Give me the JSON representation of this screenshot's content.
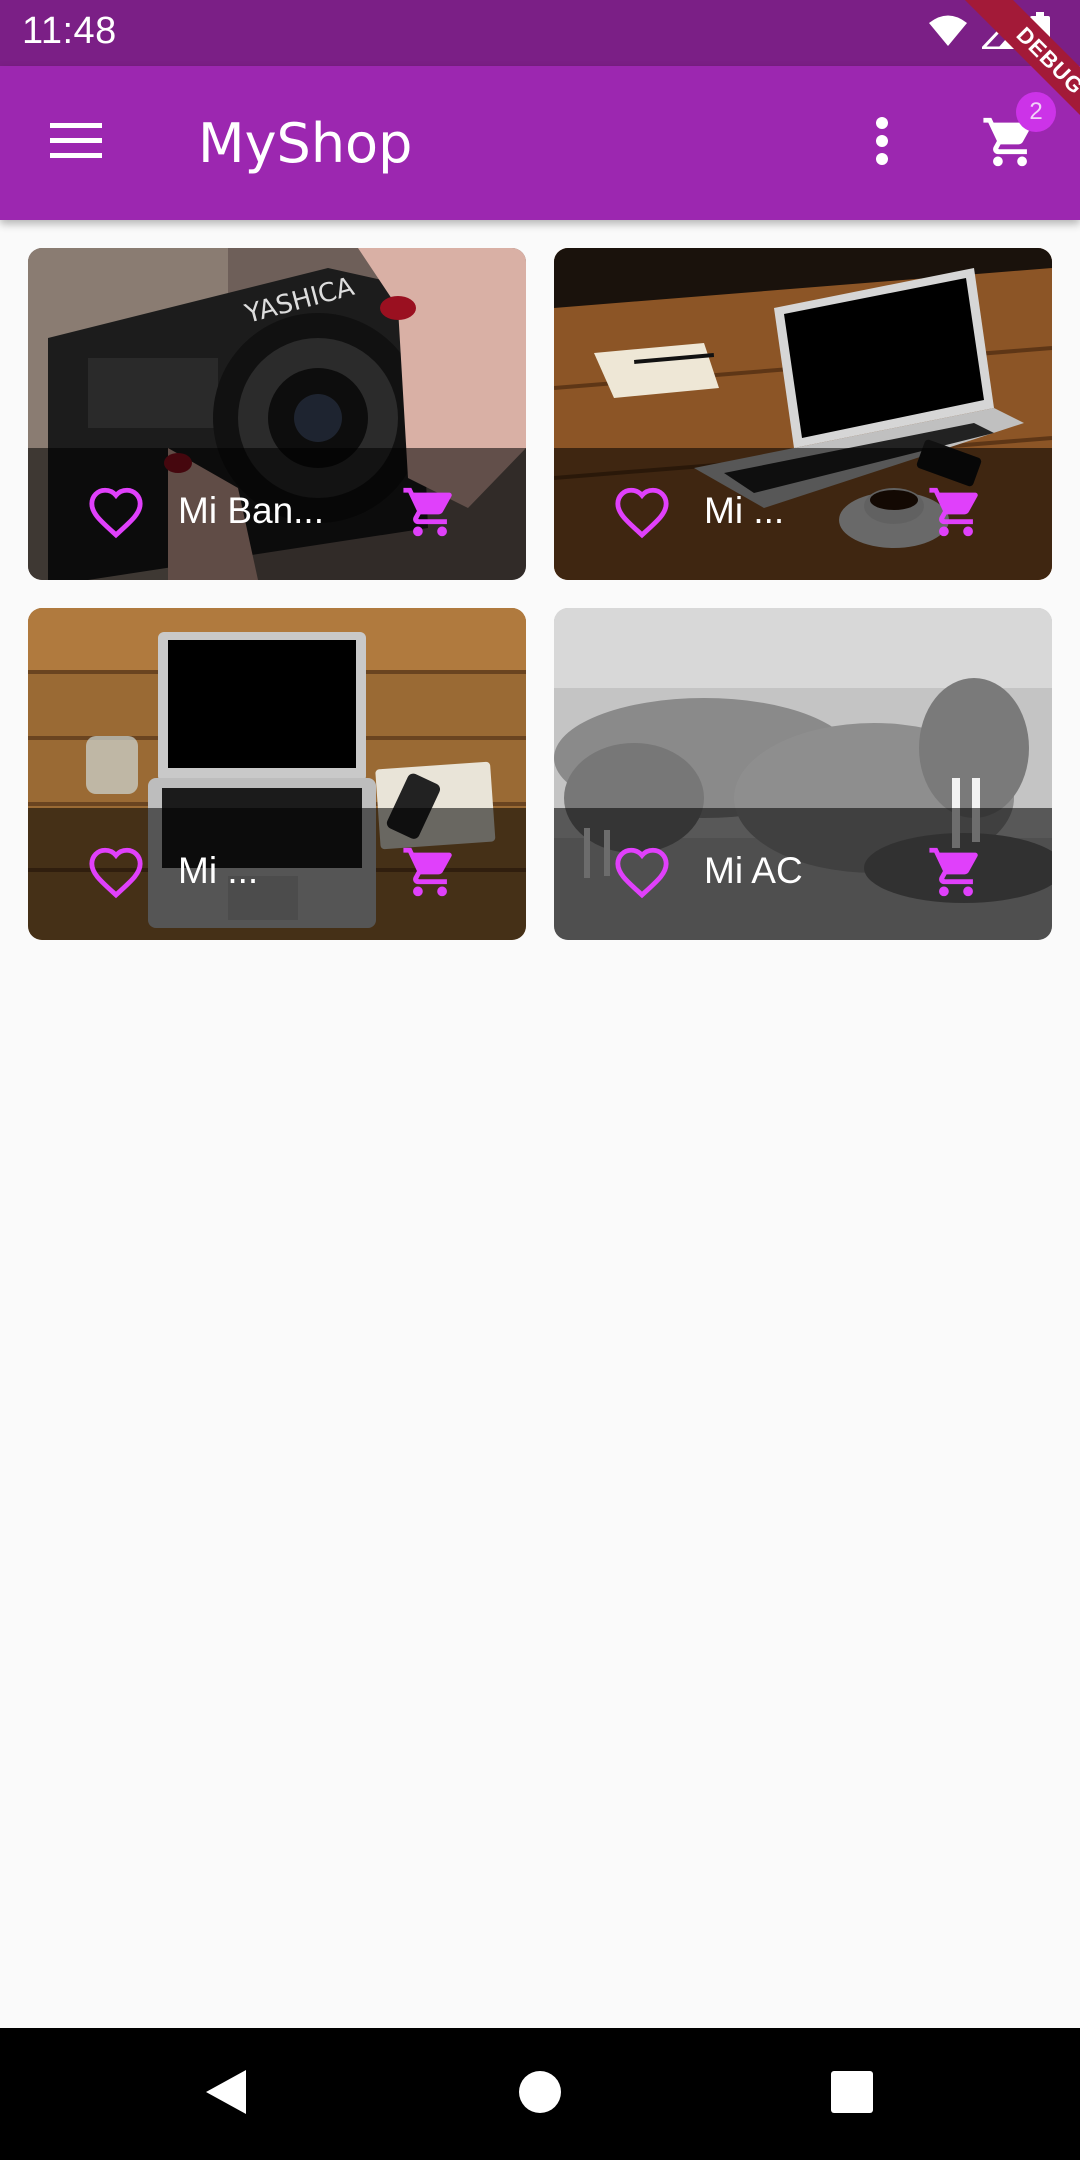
{
  "status_bar": {
    "time": "11:48",
    "icons": [
      "wifi-icon",
      "signal-icon",
      "battery-icon"
    ]
  },
  "debug_banner": "DEBUG",
  "app_bar": {
    "title": "MyShop",
    "menu_icon": "menu-icon",
    "more_icon": "more-vert-icon",
    "cart_icon": "shopping-cart-icon",
    "cart_badge": "2"
  },
  "products": [
    {
      "title": "Mi Ban...",
      "fav_icon": "heart-outline-icon",
      "cart_icon": "shopping-cart-icon",
      "image": "camera-photo"
    },
    {
      "title": "Mi ...",
      "fav_icon": "heart-outline-icon",
      "cart_icon": "shopping-cart-icon",
      "image": "laptop-on-table-photo"
    },
    {
      "title": "Mi ...",
      "fav_icon": "heart-outline-icon",
      "cart_icon": "shopping-cart-icon",
      "image": "laptop-desk-photo"
    },
    {
      "title": "Mi AC",
      "fav_icon": "heart-outline-icon",
      "cart_icon": "shopping-cart-icon",
      "image": "walrus-photo"
    }
  ],
  "nav_bar": {
    "icons": [
      "back-icon",
      "home-icon",
      "recents-icon"
    ]
  },
  "colors": {
    "status_bar": "#7b1f86",
    "app_bar": "#9c27b0",
    "accent": "#e040fb",
    "background": "#fafafa"
  }
}
